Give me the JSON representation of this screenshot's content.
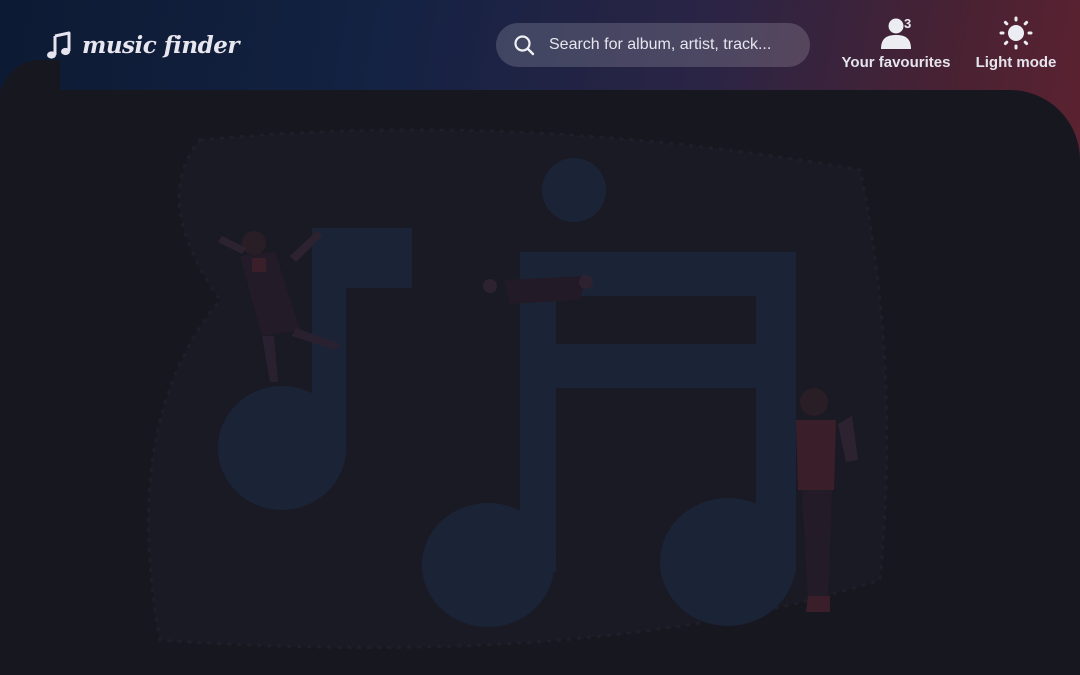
{
  "app": {
    "name": "music finder"
  },
  "search": {
    "placeholder": "Search for album, artist, track..."
  },
  "nav": {
    "favourites": {
      "label": "Your favourites",
      "count": "3",
      "icon": "user-icon"
    },
    "theme": {
      "label": "Light mode",
      "icon": "sun-icon"
    }
  },
  "illustration": {
    "icon": "music-notes-illustration"
  },
  "colors": {
    "background": "#17171f",
    "header_start": "#0c1a33",
    "header_end": "#5c2231",
    "note_fill": "#1b2436",
    "figure_accent": "#3a1f2a"
  }
}
